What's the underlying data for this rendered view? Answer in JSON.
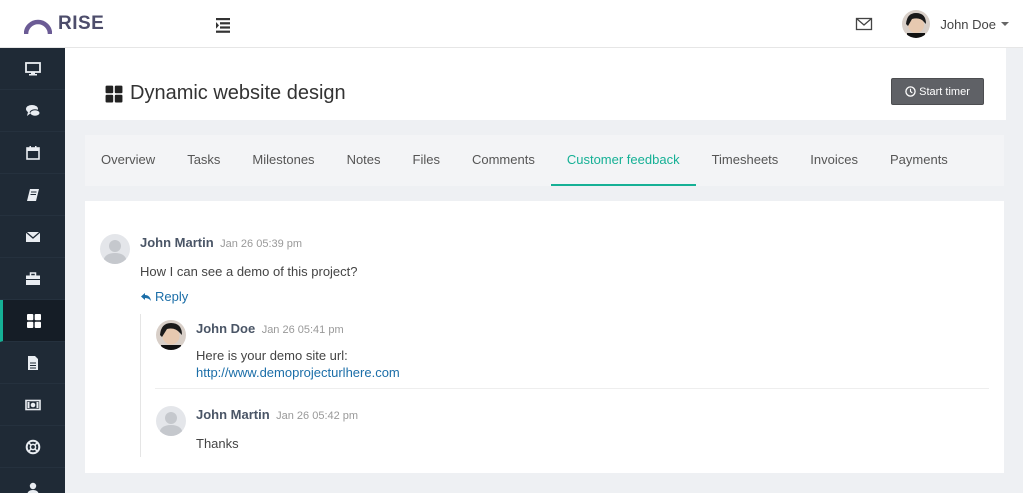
{
  "app": {
    "name": "RISE"
  },
  "user": {
    "name": "John Doe"
  },
  "project": {
    "title": "Dynamic website design",
    "timer_label": "Start timer"
  },
  "tabs": [
    {
      "label": "Overview"
    },
    {
      "label": "Tasks"
    },
    {
      "label": "Milestones"
    },
    {
      "label": "Notes"
    },
    {
      "label": "Files"
    },
    {
      "label": "Comments"
    },
    {
      "label": "Customer feedback"
    },
    {
      "label": "Timesheets"
    },
    {
      "label": "Invoices"
    },
    {
      "label": "Payments"
    }
  ],
  "active_tab": "Customer feedback",
  "sidebar": {
    "items": [
      {
        "icon": "desktop-icon",
        "name": "dashboard"
      },
      {
        "icon": "chat-icon",
        "name": "messages-chat"
      },
      {
        "icon": "calendar-icon",
        "name": "events"
      },
      {
        "icon": "book-icon",
        "name": "notes"
      },
      {
        "icon": "envelope-icon",
        "name": "messages"
      },
      {
        "icon": "briefcase-icon",
        "name": "clients"
      },
      {
        "icon": "grid-icon",
        "name": "projects"
      },
      {
        "icon": "file-icon",
        "name": "invoices"
      },
      {
        "icon": "money-icon",
        "name": "payments"
      },
      {
        "icon": "lifebuoy-icon",
        "name": "support"
      },
      {
        "icon": "user-icon",
        "name": "team"
      }
    ],
    "active": "projects"
  },
  "feedback": {
    "comment": {
      "author": "John Martin",
      "time": "Jan 26 05:39 pm",
      "text": "How I can see a demo of this project?"
    },
    "reply_label": "Reply",
    "replies": [
      {
        "author": "John Doe",
        "time": "Jan 26 05:41 pm",
        "text": "Here is your demo site url:",
        "link": "http://www.demoprojecturlhere.com"
      },
      {
        "author": "John Martin",
        "time": "Jan 26 05:42 pm",
        "text": "Thanks"
      }
    ]
  },
  "colors": {
    "accent": "#15b095",
    "sidebar": "#1f2a36",
    "link": "#1b6ea8",
    "logo": "#6b5b95"
  }
}
